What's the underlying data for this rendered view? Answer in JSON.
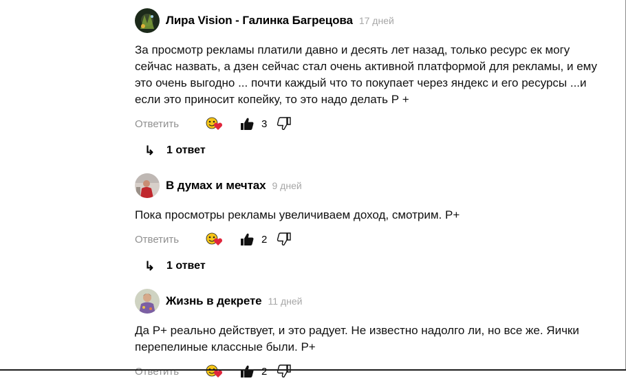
{
  "comments": [
    {
      "author": "Лира Vision - Галинка Багрецова",
      "age": "17 дней",
      "text": "За просмотр рекламы платили давно и десять лет назад, только ресурс ек могу сейчас назвать, а дзен сейчас стал очень активной платформой для рекламы, и ему это очень выгодно ... почти каждый что то покупает через яндекс и его ресурсы ...и если это приносит копейку, то это надо делать Р +",
      "reply_label": "Ответить",
      "likes": "3",
      "replies_label": "1 ответ"
    },
    {
      "author": "В думах и мечтах",
      "age": "9 дней",
      "text": "Пока просмотры рекламы увеличиваем доход, смотрим. Р+",
      "reply_label": "Ответить",
      "likes": "2",
      "replies_label": "1 ответ"
    },
    {
      "author": "Жизнь в декрете",
      "age": "11 дней",
      "text": "Да Р+ реально действует, и это радует. Не известно надолго ли, но все же. Яички перепелиные классные были. Р+",
      "reply_label": "Ответить",
      "likes": "2"
    }
  ],
  "icons": {
    "reply_arrow": "reply-arrow-icon",
    "like": "thumbs-up-icon",
    "dislike": "thumbs-down-icon",
    "reactions": "reactions-emoji-icon"
  },
  "colors": {
    "muted": "#8f8f8f",
    "age": "#a6a6a6",
    "heart": "#e0263c",
    "emoji": "#f5c518"
  }
}
